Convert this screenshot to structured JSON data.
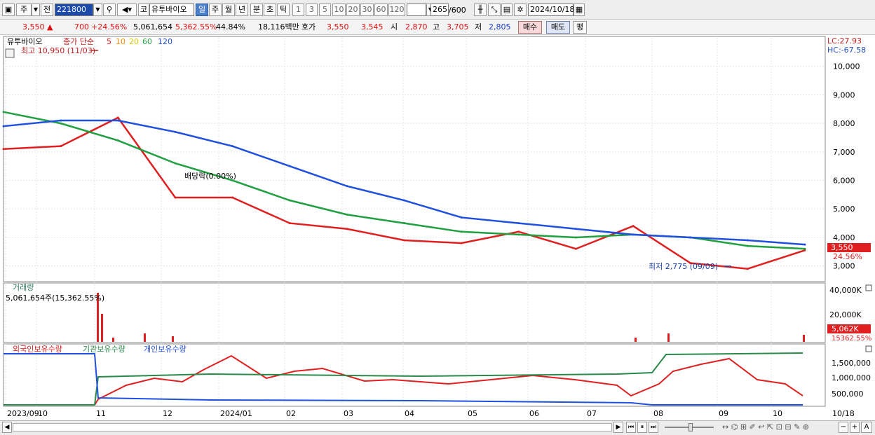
{
  "toolbar": {
    "period_mode": "주",
    "prev": "전",
    "stock_code": "221800",
    "market_code": "코",
    "stock_name": "유투바이오",
    "tabs": [
      "일",
      "주",
      "월",
      "년",
      "분",
      "초",
      "틱"
    ],
    "selected_tab": "일",
    "intervals": [
      "1",
      "3",
      "5",
      "10",
      "20",
      "30",
      "60",
      "120"
    ],
    "count_display": "265",
    "count_total": "/600",
    "date": "2024/10/18"
  },
  "quote": {
    "price": "3,550",
    "change_arrow": "▲",
    "change": "700",
    "change_pct": "+24.56%",
    "volume": "5,061,654",
    "volume_ratio": "5,362.55%",
    "turnover": "44.84%",
    "amount": "18,116백만",
    "bid_label": "호가",
    "ask": "3,550",
    "bid": "3,545",
    "open_label": "시",
    "open": "2,870",
    "high_label": "고",
    "high": "3,705",
    "low_label": "저",
    "low": "2,805",
    "buy_button": "매수",
    "sell_button": "매도",
    "eval_button": "평"
  },
  "price_panel": {
    "legend_name": "유투바이오",
    "legend_ma": "종가 단순",
    "ma_periods": [
      "5",
      "10",
      "20",
      "60",
      "120"
    ],
    "ma_colors": [
      "#e02020",
      "#ff8c00",
      "#f0e020",
      "#20a040",
      "#2050e0"
    ],
    "high_annotation": "최고 10,950 (11/03)",
    "low_annotation": "최저 2,775 (09/09)",
    "dividend_annotation": "배당락(0.00%)",
    "lc": "LC:27.93",
    "hc": "HC:-67.58",
    "current_price_tag": "3,550",
    "current_pct_tag": "24.56%",
    "y_ticks": [
      "10,000",
      "9,000",
      "8,000",
      "7,000",
      "6,000",
      "5,000",
      "4,000",
      "3,000"
    ]
  },
  "volume_panel": {
    "title": "거래량",
    "summary": "5,061,654주(15,362.55%)",
    "y_ticks": [
      "40,000K",
      "20,000K"
    ],
    "tag_value": "5,062K",
    "tag_pct": "15362.55%"
  },
  "holding_panel": {
    "series": [
      {
        "name": "외국인보유수량",
        "color": "#e02020"
      },
      {
        "name": "기관보유수량",
        "color": "#2a8a4a"
      },
      {
        "name": "개인보유수량",
        "color": "#2050e0"
      }
    ],
    "y_ticks": [
      "1,500,000",
      "1,000,000",
      "500,000"
    ]
  },
  "x_axis": {
    "labels": [
      "2023/09",
      "10",
      "11",
      "12",
      "2024/01",
      "02",
      "03",
      "04",
      "05",
      "06",
      "07",
      "08",
      "09",
      "10"
    ],
    "right_label": "10/18"
  },
  "chart_data": {
    "type": "line",
    "title": "유투바이오",
    "x": [
      "2023/09",
      "10",
      "11",
      "12",
      "2024/01",
      "02",
      "03",
      "04",
      "05",
      "06",
      "07",
      "08",
      "09",
      "10",
      "10/18"
    ],
    "series": [
      {
        "name": "5",
        "values": [
          7100,
          7200,
          8200,
          5400,
          5400,
          4500,
          4300,
          3900,
          3800,
          4200,
          3600,
          4400,
          3100,
          2900,
          3550
        ]
      },
      {
        "name": "60",
        "values": [
          8400,
          8000,
          7400,
          6600,
          6000,
          5300,
          4800,
          4500,
          4200,
          4100,
          4000,
          4100,
          4000,
          3700,
          3600
        ]
      },
      {
        "name": "120",
        "values": [
          7900,
          8100,
          8100,
          7700,
          7200,
          6500,
          5800,
          5300,
          4700,
          4500,
          4300,
          4100,
          4000,
          3900,
          3750
        ]
      }
    ],
    "ylim": [
      2500,
      11000
    ]
  }
}
